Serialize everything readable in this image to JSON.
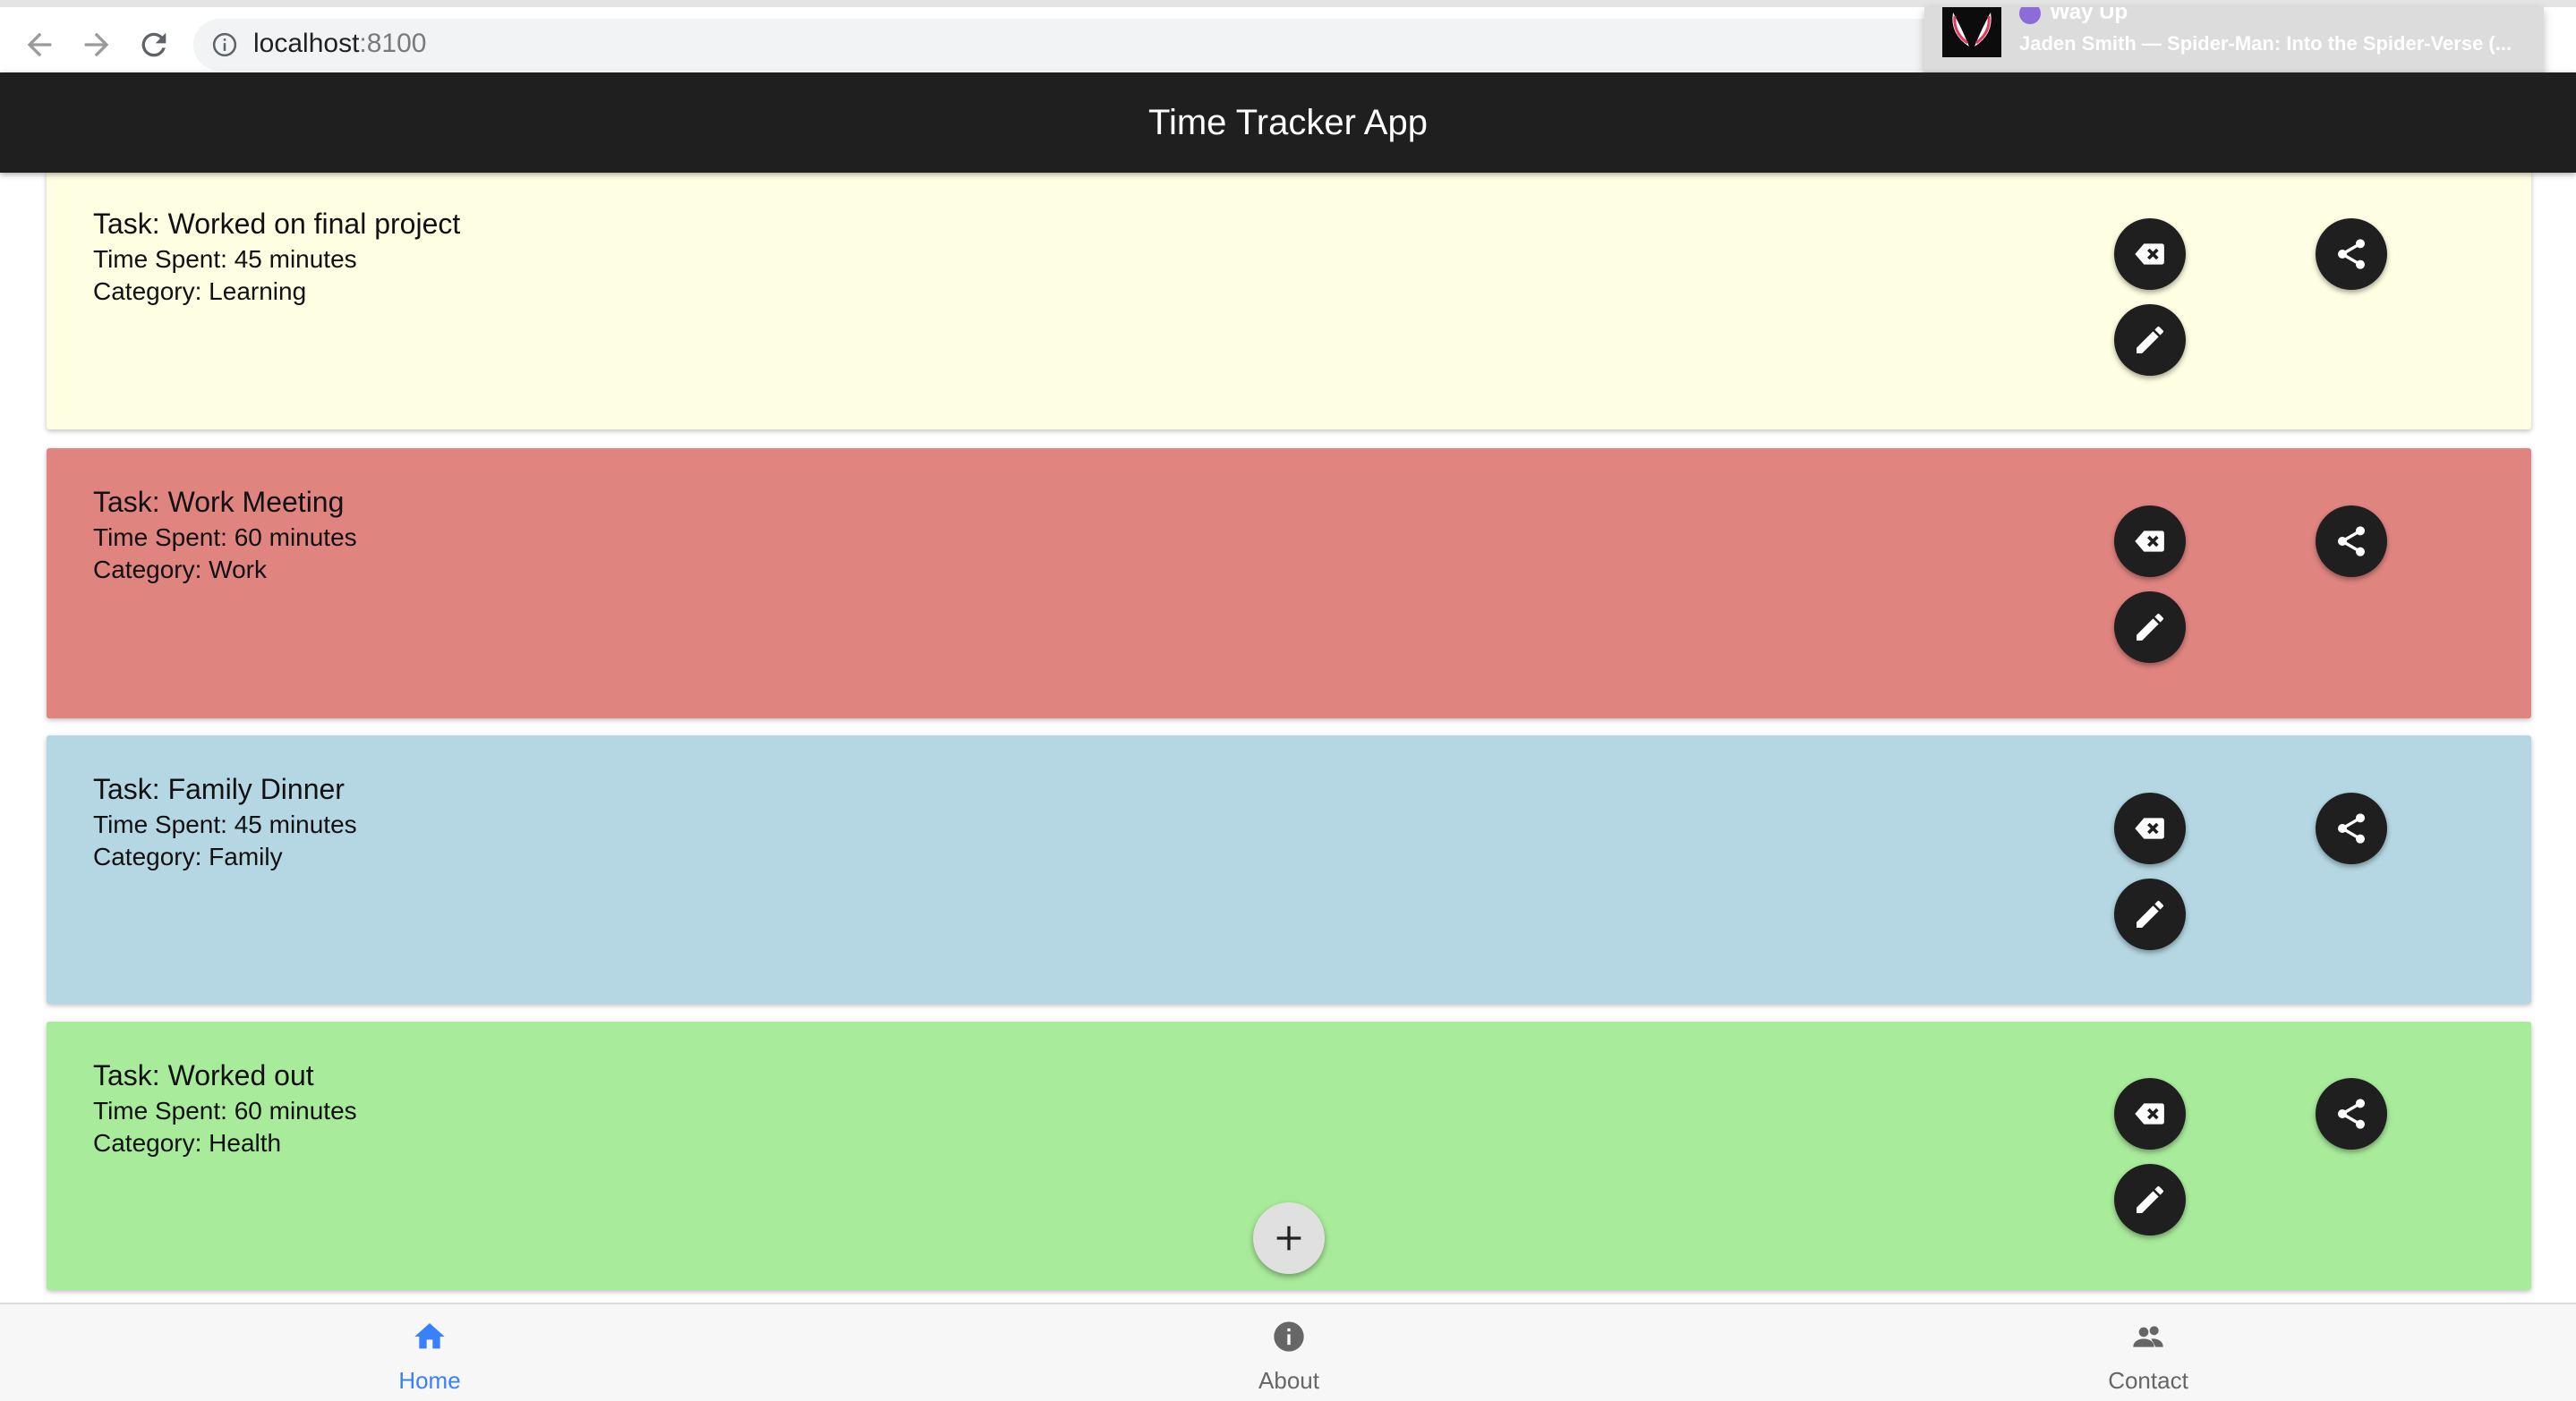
{
  "browser": {
    "url_host": "localhost",
    "url_port": ":8100",
    "media": {
      "title": "Way Up",
      "artist_line": "Jaden Smith — Spider-Man: Into the Spider-Verse (..."
    }
  },
  "header": {
    "title": "Time Tracker App"
  },
  "tasks": [
    {
      "title": "Task: Worked on final project",
      "time": "Time Spent: 45 minutes",
      "category": "Category: Learning",
      "color": "#fefee2"
    },
    {
      "title": "Task: Work Meeting",
      "time": "Time Spent: 60 minutes",
      "category": "Category: Work",
      "color": "#e08480"
    },
    {
      "title": "Task: Family Dinner",
      "time": "Time Spent: 45 minutes",
      "category": "Category: Family",
      "color": "#b4d7e3"
    },
    {
      "title": "Task: Worked out",
      "time": "Time Spent: 60 minutes",
      "category": "Category: Health",
      "color": "#a8eb9a"
    }
  ],
  "icons": {
    "delete": "backspace-icon",
    "edit": "pencil-icon",
    "share": "share-icon",
    "add": "plus-icon"
  },
  "tabs": [
    {
      "label": "Home",
      "icon": "home-icon",
      "active": true,
      "color": "#3880ff"
    },
    {
      "label": "About",
      "icon": "info-icon",
      "active": false,
      "color": "#666666"
    },
    {
      "label": "Contact",
      "icon": "people-icon",
      "active": false,
      "color": "#666666"
    }
  ]
}
